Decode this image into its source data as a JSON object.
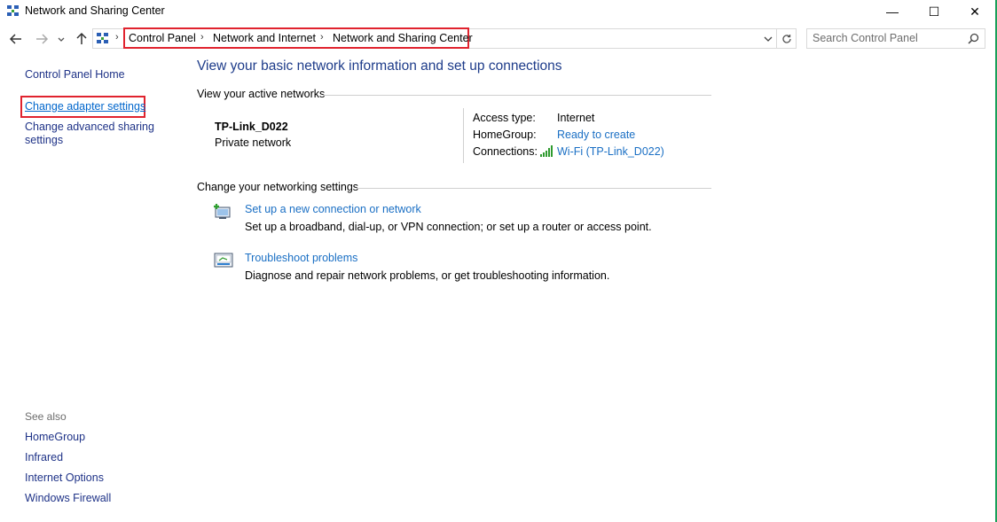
{
  "window": {
    "title": "Network and Sharing Center",
    "controls": {
      "minimize": "—",
      "maximize": "☐",
      "close": "✕"
    }
  },
  "navigation": {
    "back_icon": "back-arrow-icon",
    "forward_icon": "forward-arrow-icon",
    "recent_icon": "chevron-down-icon",
    "up_icon": "up-arrow-icon",
    "breadcrumb": [
      "Control Panel",
      "Network and Internet",
      "Network and Sharing Center"
    ],
    "highlight_color": "#e0232e"
  },
  "search": {
    "placeholder": "Search Control Panel"
  },
  "sidebar": {
    "home": "Control Panel Home",
    "change_adapter": "Change adapter settings",
    "change_advanced_line1": "Change advanced sharing",
    "change_advanced_line2": "settings",
    "see_also_title": "See also",
    "see_also": [
      "HomeGroup",
      "Infrared",
      "Internet Options",
      "Windows Firewall"
    ]
  },
  "main": {
    "title": "View your basic network information and set up connections",
    "active_networks_header": "View your active networks",
    "network": {
      "name": "TP-Link_D022",
      "type": "Private network",
      "access_type_label": "Access type:",
      "access_type_value": "Internet",
      "homegroup_label": "HomeGroup:",
      "homegroup_value": "Ready to create",
      "connections_label": "Connections:",
      "connections_value": "Wi-Fi (TP-Link_D022)"
    },
    "settings_header": "Change your networking settings",
    "tasks": [
      {
        "link": "Set up a new connection or network",
        "description": "Set up a broadband, dial-up, or VPN connection; or set up a router or access point."
      },
      {
        "link": "Troubleshoot problems",
        "description": "Diagnose and repair network problems, or get troubleshooting information."
      }
    ]
  },
  "colors": {
    "link": "#1a6fc4",
    "title": "#1e3c8a",
    "accent_edge": "#1aa05a"
  }
}
